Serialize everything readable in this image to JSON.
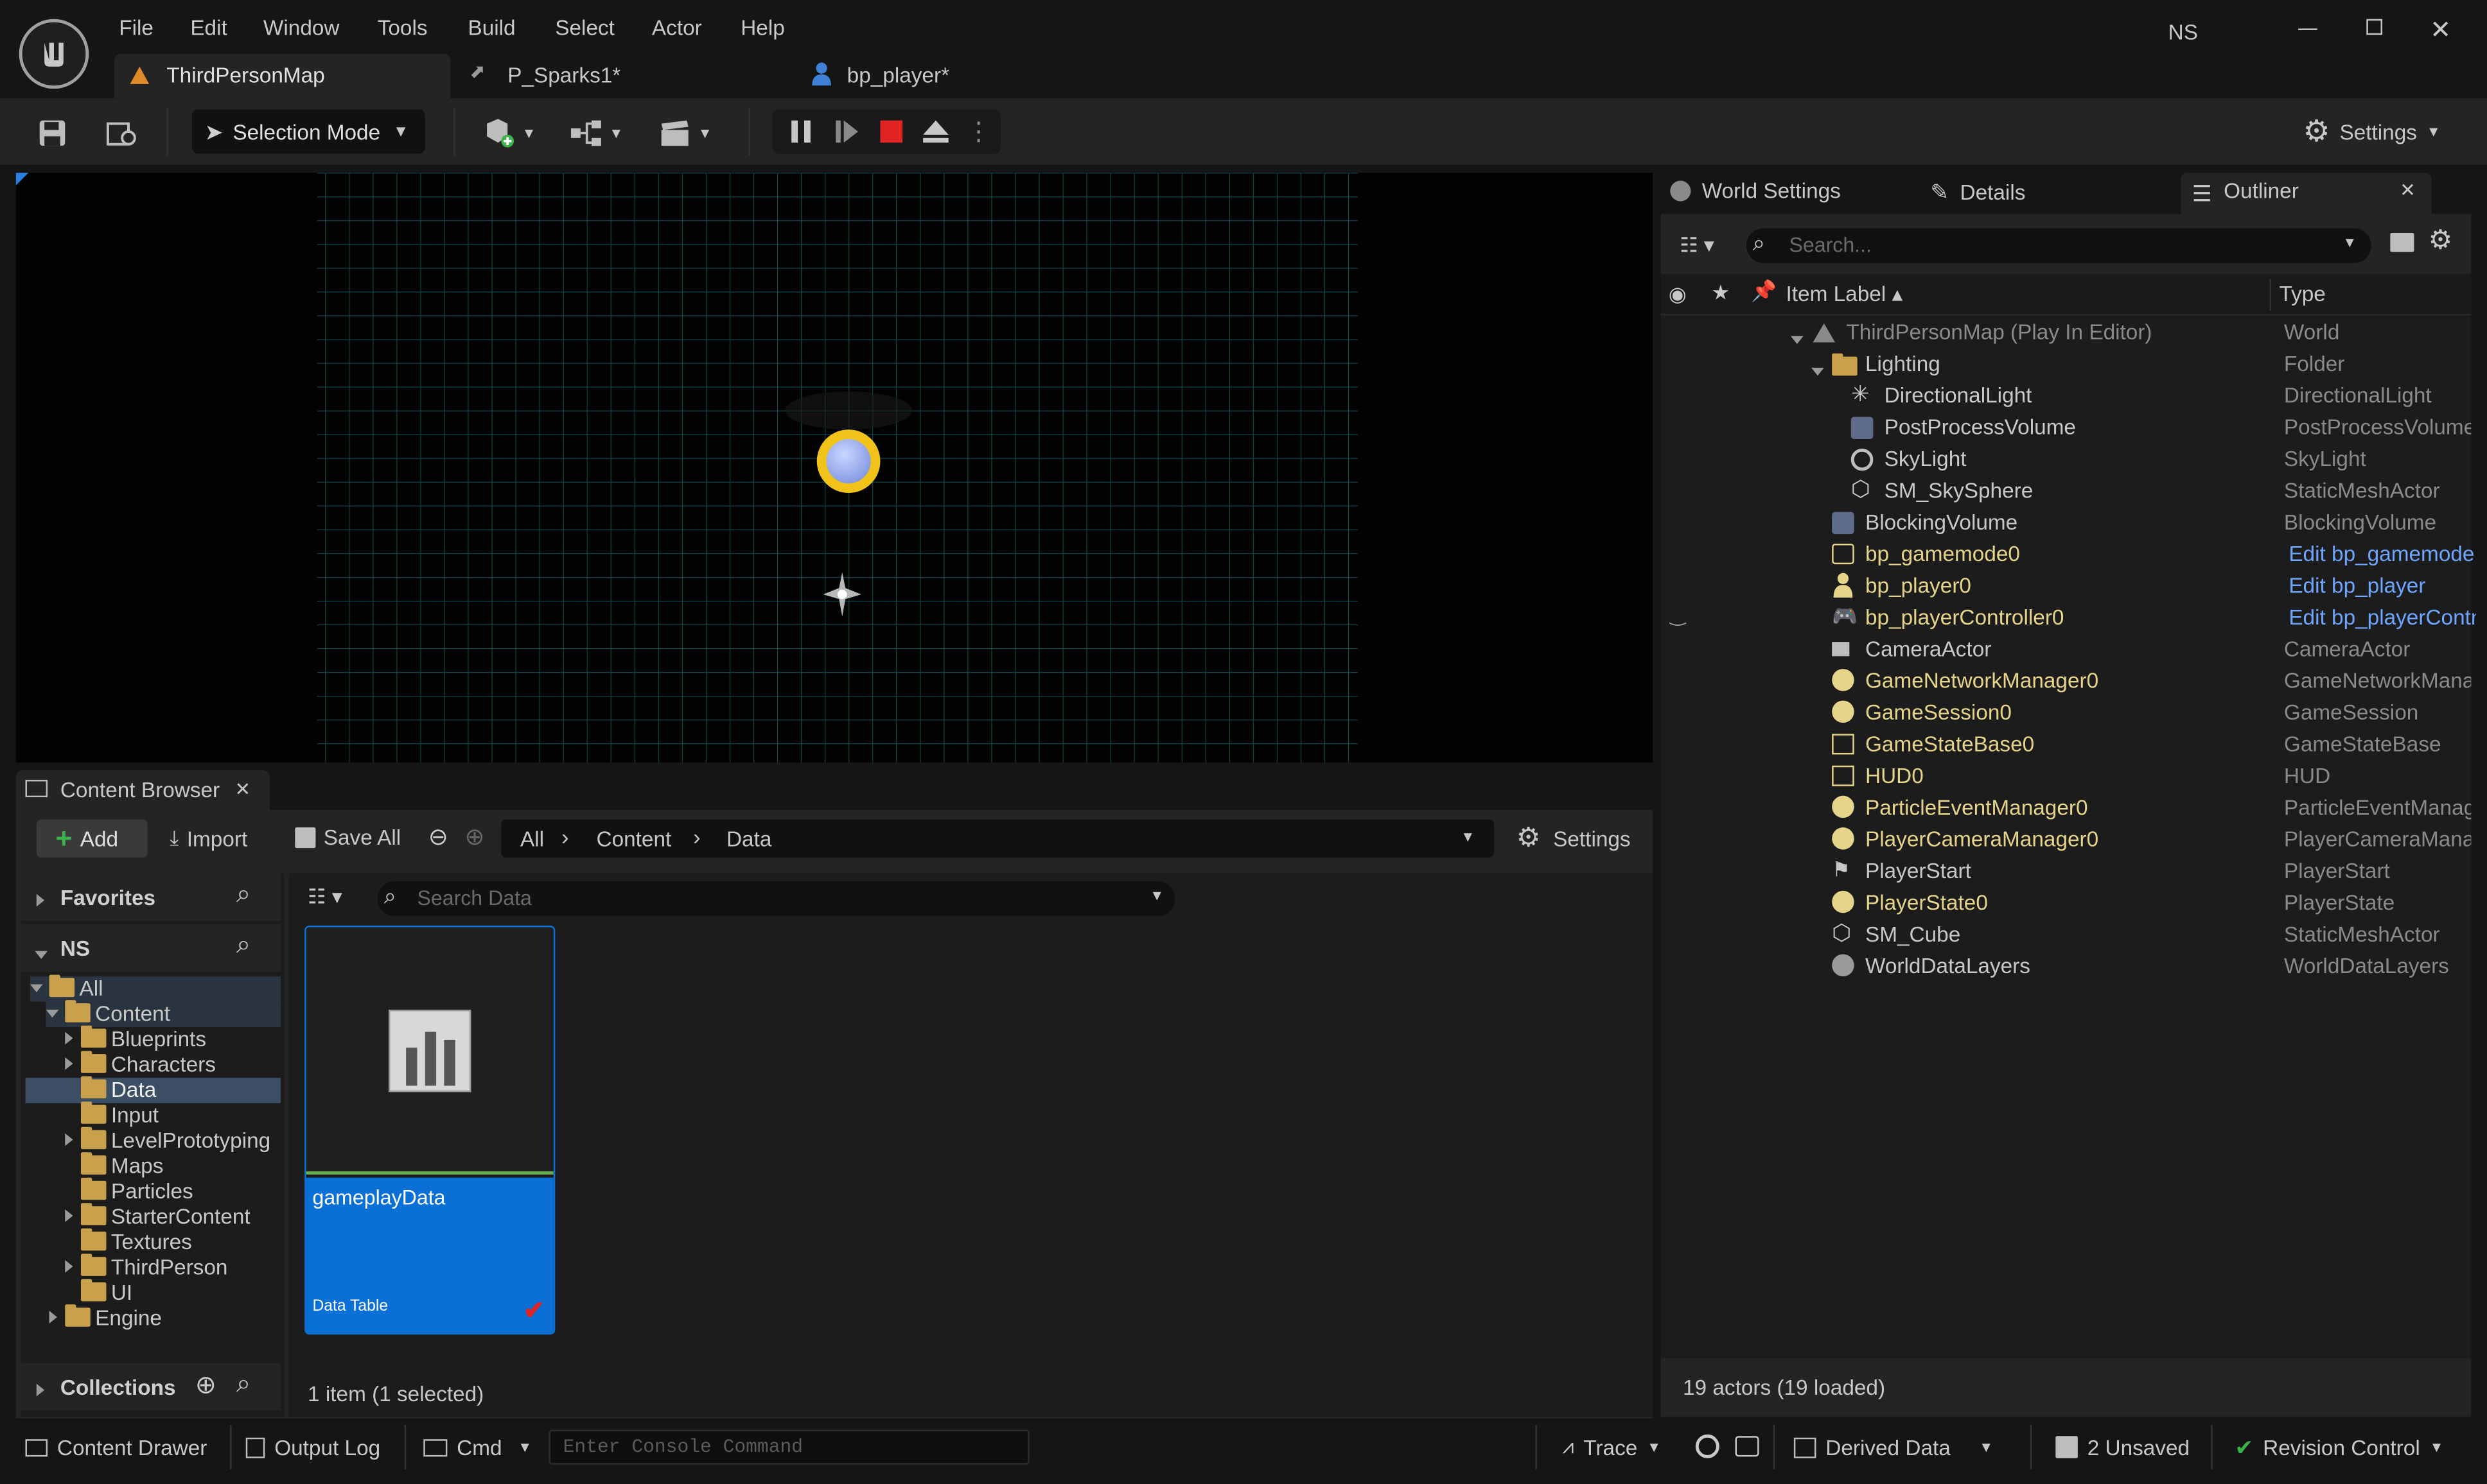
{
  "menu": [
    "File",
    "Edit",
    "Window",
    "Tools",
    "Build",
    "Select",
    "Actor",
    "Help"
  ],
  "user_initials": "NS",
  "tabs": [
    {
      "label": "ThirdPersonMap",
      "icon": "level-icon"
    },
    {
      "label": "P_Sparks1*",
      "icon": "particle-icon"
    },
    {
      "label": "bp_player*",
      "icon": "blueprint-pawn-icon"
    }
  ],
  "toolbar": {
    "selection_mode": "Selection Mode",
    "settings": "Settings"
  },
  "right_panel": {
    "tabs": [
      "World Settings",
      "Details",
      "Outliner"
    ],
    "search_placeholder": "Search...",
    "col_label": "Item Label",
    "col_type": "Type",
    "rows": [
      {
        "label": "ThirdPersonMap (Play In Editor)",
        "type": "World"
      },
      {
        "label": "Lighting",
        "type": "Folder"
      },
      {
        "label": "DirectionalLight",
        "type": "DirectionalLight"
      },
      {
        "label": "PostProcessVolume",
        "type": "PostProcessVolume"
      },
      {
        "label": "SkyLight",
        "type": "SkyLight"
      },
      {
        "label": "SM_SkySphere",
        "type": "StaticMeshActor"
      },
      {
        "label": "BlockingVolume",
        "type": "BlockingVolume"
      },
      {
        "label": "bp_gamemode0",
        "type": "Edit bp_gamemode"
      },
      {
        "label": "bp_player0",
        "type": "Edit bp_player"
      },
      {
        "label": "bp_playerController0",
        "type": "Edit bp_playerController"
      },
      {
        "label": "CameraActor",
        "type": "CameraActor"
      },
      {
        "label": "GameNetworkManager0",
        "type": "GameNetworkManager"
      },
      {
        "label": "GameSession0",
        "type": "GameSession"
      },
      {
        "label": "GameStateBase0",
        "type": "GameStateBase"
      },
      {
        "label": "HUD0",
        "type": "HUD"
      },
      {
        "label": "ParticleEventManager0",
        "type": "ParticleEventManager"
      },
      {
        "label": "PlayerCameraManager0",
        "type": "PlayerCameraManager"
      },
      {
        "label": "PlayerStart",
        "type": "PlayerStart"
      },
      {
        "label": "PlayerState0",
        "type": "PlayerState"
      },
      {
        "label": "SM_Cube",
        "type": "StaticMeshActor"
      },
      {
        "label": "WorldDataLayers",
        "type": "WorldDataLayers"
      }
    ],
    "footer": "19 actors (19 loaded)"
  },
  "content_browser": {
    "title": "Content Browser",
    "add": "Add",
    "import": "Import",
    "save_all": "Save All",
    "breadcrumb": [
      "All",
      "Content",
      "Data"
    ],
    "settings": "Settings",
    "favorites": "Favorites",
    "ns": "NS",
    "tree": {
      "all": "All",
      "content": "Content",
      "blueprints": "Blueprints",
      "characters": "Characters",
      "data": "Data",
      "input": "Input",
      "levelprototyping": "LevelPrototyping",
      "maps": "Maps",
      "particles": "Particles",
      "startercontent": "StarterContent",
      "textures": "Textures",
      "thirdperson": "ThirdPerson",
      "ui": "UI",
      "engine": "Engine"
    },
    "collections": "Collections",
    "search_placeholder": "Search Data",
    "asset": {
      "name": "gameplayData",
      "type": "Data Table"
    },
    "status": "1 item (1 selected)"
  },
  "statusbar": {
    "content_drawer": "Content Drawer",
    "output_log": "Output Log",
    "cmd": "Cmd",
    "console_placeholder": "Enter Console Command",
    "trace": "Trace",
    "derived_data": "Derived Data",
    "unsaved": "2 Unsaved",
    "revision_control": "Revision Control"
  },
  "colors": {
    "accent": "#0a70d6",
    "selected_row": "#2f4256",
    "link": "#6ea6ff",
    "stop": "#e02424"
  }
}
